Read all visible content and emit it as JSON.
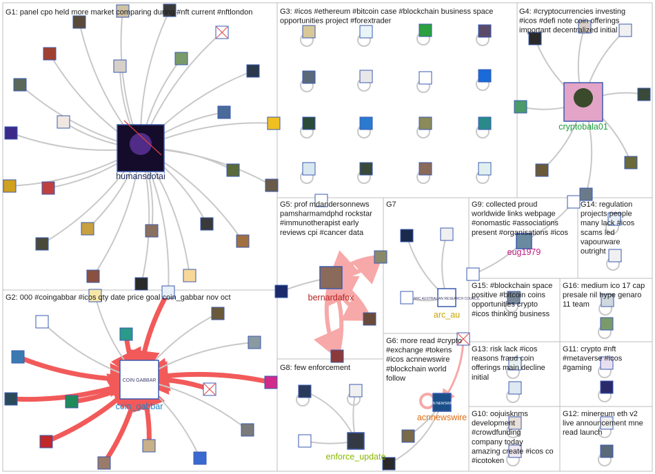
{
  "accent_colors": {
    "edge_gray": "#c8c8c8",
    "edge_red": "#f25a5a",
    "edge_pink": "#f7a8a8",
    "hub_humansdotai": "#1a2a5e",
    "hub_cryptobala01": "#1b9c3a",
    "hub_bernardafox": "#b21f1f",
    "hub_arc_au": "#c9a400",
    "hub_eug1979": "#c0187e",
    "hub_coin_gabbar": "#1e7fc2",
    "hub_acnnewswire": "#e06a10",
    "hub_enforce_update": "#8ab800"
  },
  "groups": [
    {
      "id": "G1",
      "lines": [
        "G1: panel cpo held more market comparing during #nft current #nftlondon"
      ]
    },
    {
      "id": "G2",
      "lines": [
        "G2: 000 #coingabbar #icos qty date price goal coin_gabbar nov oct"
      ]
    },
    {
      "id": "G3",
      "lines": [
        "G3: #icos #ethereum #bitcoin case #blockchain business space",
        "opportunities project #forextrader"
      ]
    },
    {
      "id": "G4",
      "lines": [
        "G4: #cryptocurrencies investing",
        "#icos #defi note coin offerings",
        "important decentralized initial"
      ]
    },
    {
      "id": "G5",
      "lines": [
        "G5: prof mdandersonnews",
        "pamsharmamdphd rockstar",
        "#immunotherapist early",
        "reviews cpi #cancer data"
      ]
    },
    {
      "id": "G6",
      "lines": [
        "G6: more read #crypto",
        "#exchange #tokens",
        "#icos acnnewswire",
        "#blockchain world",
        "follow"
      ]
    },
    {
      "id": "G7",
      "lines": [
        "G7"
      ]
    },
    {
      "id": "G8",
      "lines": [
        "G8: few enforcement"
      ]
    },
    {
      "id": "G9",
      "lines": [
        "G9: collected proud",
        "worldwide links webpage",
        "#onomastic #associations",
        "present #organisations #icos"
      ]
    },
    {
      "id": "G10",
      "lines": [
        "G10: oojuisknms",
        "development",
        "#crowdfunding",
        "company today",
        "amazing create #icos co",
        "#icotoken"
      ]
    },
    {
      "id": "G11",
      "lines": [
        "G11: crypto #nft",
        "#metaverse #icos",
        "#gaming"
      ]
    },
    {
      "id": "G12",
      "lines": [
        "G12: minereum eth v2",
        "live announcement mne",
        "read launch"
      ]
    },
    {
      "id": "G13",
      "lines": [
        "G13: risk lack #icos",
        "reasons fraud coin",
        "offerings main decline",
        "initial"
      ]
    },
    {
      "id": "G14",
      "lines": [
        "G14: regulation",
        "projects people",
        "many lack #icos",
        "scams led",
        "vapourware",
        "outright"
      ]
    },
    {
      "id": "G15",
      "lines": [
        "G15: #blockchain space",
        "positive #bitcoin coins",
        "opportunities crypto",
        "#icos thinking business"
      ]
    },
    {
      "id": "G16",
      "lines": [
        "G16: medium ico 17 cap",
        "presale nil hype genaro",
        "11 team"
      ]
    }
  ],
  "hubs": [
    {
      "id": "humansdotai",
      "label": "humansdotai"
    },
    {
      "id": "cryptobala01",
      "label": "cryptobala01"
    },
    {
      "id": "bernardafox",
      "label": "bernardafox"
    },
    {
      "id": "arc_au",
      "label": "arc_au"
    },
    {
      "id": "eug1979",
      "label": "eug1979"
    },
    {
      "id": "coin_gabbar",
      "label": "coin_gabbar"
    },
    {
      "id": "acnnewswire",
      "label": "acnnewswire"
    },
    {
      "id": "enforce_update",
      "label": "enforce_update"
    }
  ],
  "hub_avatar_text": {
    "coin_gabbar": "COIN GABBAR",
    "arc_au": "ARC AUSTRALIAN RESEARCH COUNCIL",
    "acnnewswire": "ACN NEWSWIRE"
  }
}
